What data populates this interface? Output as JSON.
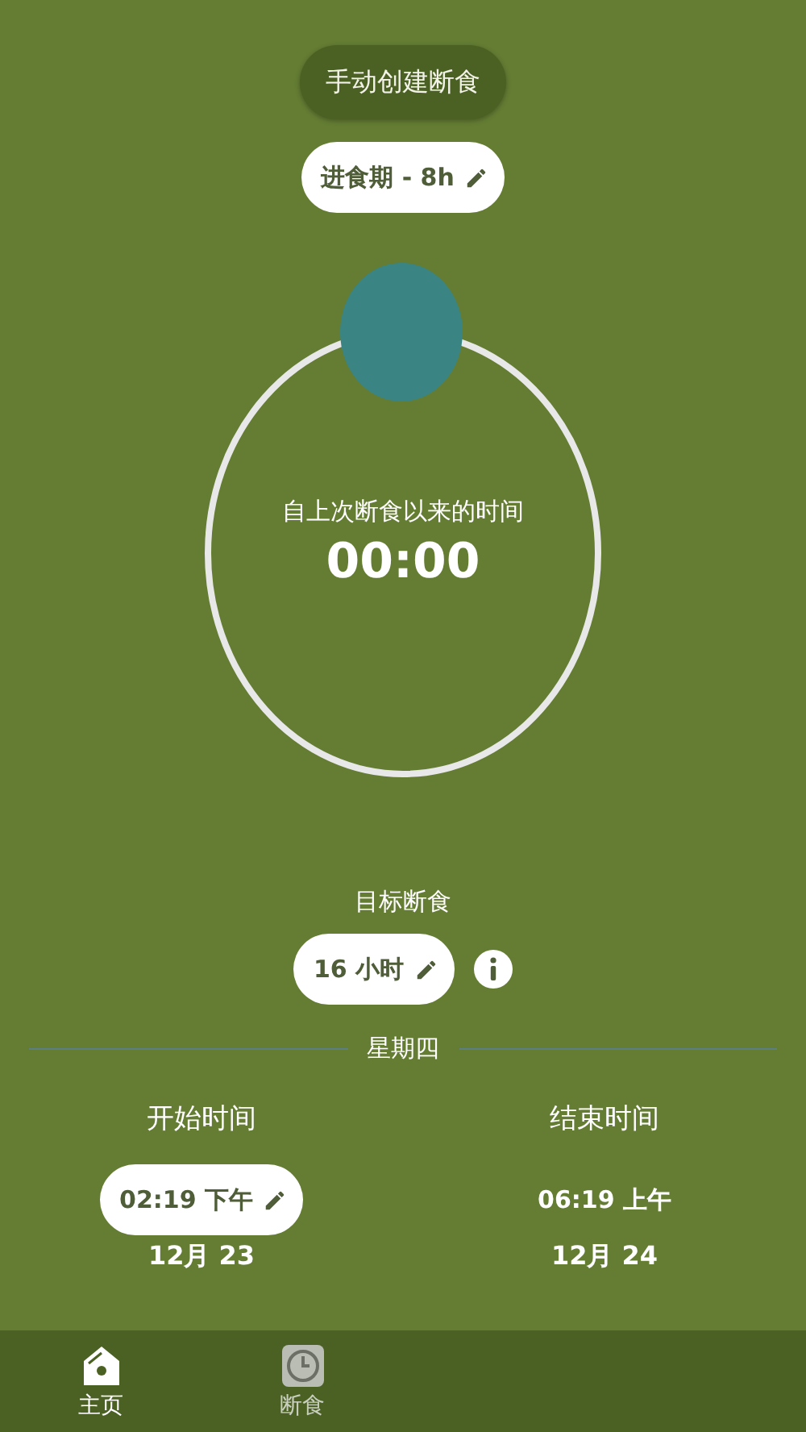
{
  "manual_button": "手动创建断食",
  "eating_window": {
    "label": "进食期 - 8h"
  },
  "timer": {
    "caption": "自上次断食以来的时间",
    "time": "00:00"
  },
  "goal": {
    "title": "目标断食",
    "value": "16 小时"
  },
  "day": "星期四",
  "start": {
    "label": "开始时间",
    "time": "02:19 下午",
    "date": "12月 23",
    "editable": true
  },
  "end": {
    "label": "结束时间",
    "time": "06:19 上午",
    "date": "12月 24",
    "editable": false
  },
  "nav": [
    {
      "kind": "home",
      "label": "主页",
      "selected": true
    },
    {
      "kind": "clock",
      "label": "断食",
      "selected": false
    }
  ]
}
